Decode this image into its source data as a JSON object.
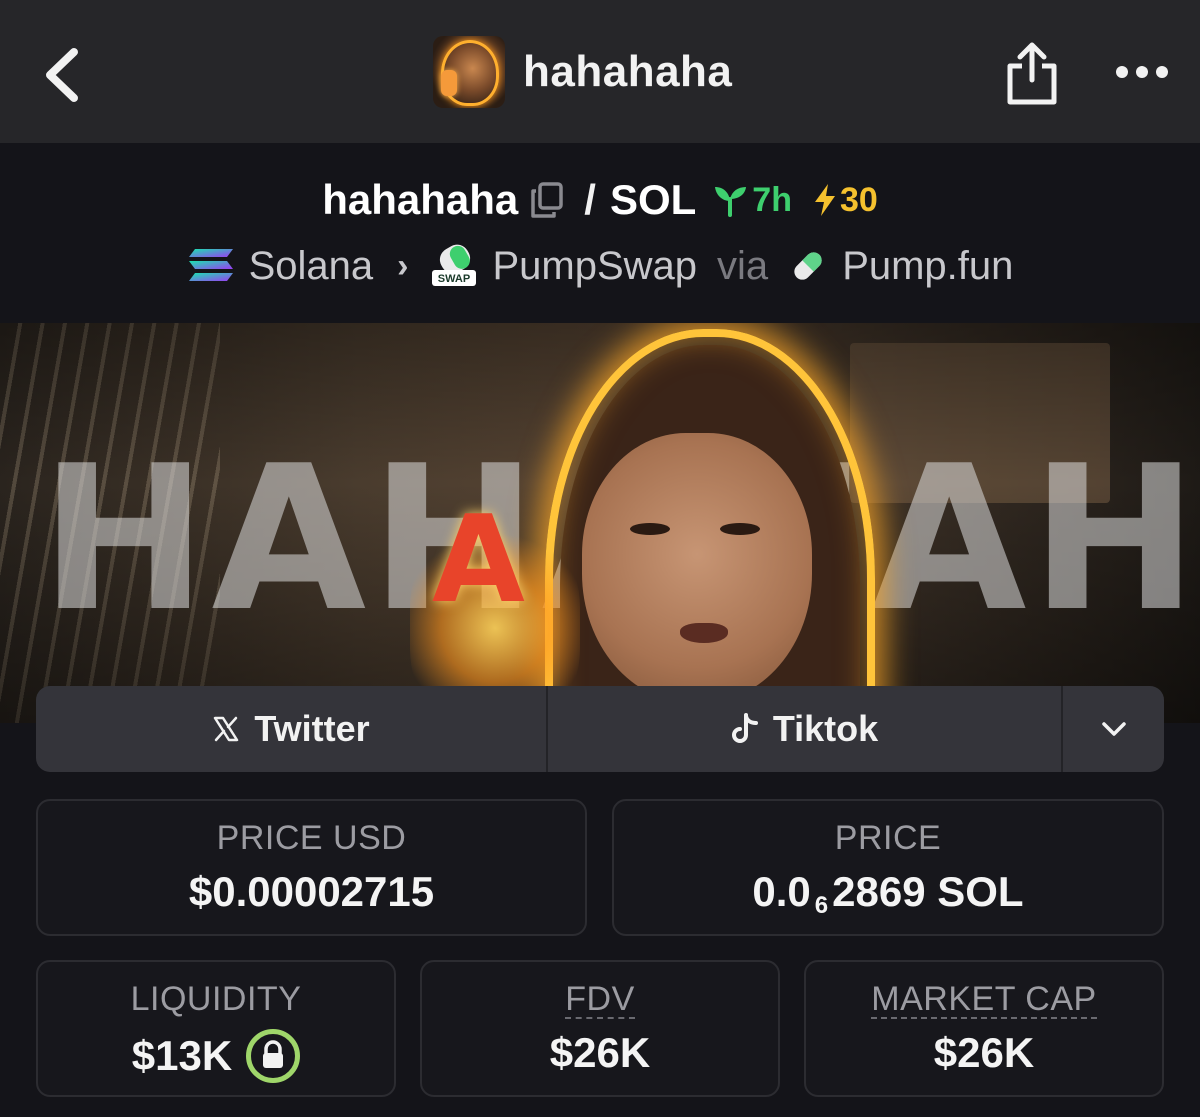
{
  "header": {
    "title": "hahahaha",
    "back_icon": "chevron-left-icon",
    "share_icon": "share-icon",
    "more_icon": "more-horizontal-icon"
  },
  "pair": {
    "base": "hahahaha",
    "separator": "/",
    "quote": "SOL",
    "age": "7h",
    "boosts": "30",
    "colors": {
      "age": "#3ecf6e",
      "boosts": "#f5c12e"
    }
  },
  "breadcrumb": {
    "chain": "Solana",
    "dex": "PumpSwap",
    "dex_badge": "SWAP",
    "via": "via",
    "launchpad": "Pump.fun"
  },
  "banner": {
    "text": "HAHAHAHA"
  },
  "socials": {
    "twitter": "Twitter",
    "tiktok": "Tiktok"
  },
  "stats": {
    "price_usd_label": "PRICE USD",
    "price_usd_value": "$0.00002715",
    "price_label": "PRICE",
    "price_prefix": "0.0",
    "price_sub": "6",
    "price_suffix": "2869 SOL",
    "liquidity_label": "LIQUIDITY",
    "liquidity_value": "$13K",
    "fdv_label": "FDV",
    "fdv_value": "$26K",
    "mcap_label": "MARKET CAP",
    "mcap_value": "$26K"
  }
}
